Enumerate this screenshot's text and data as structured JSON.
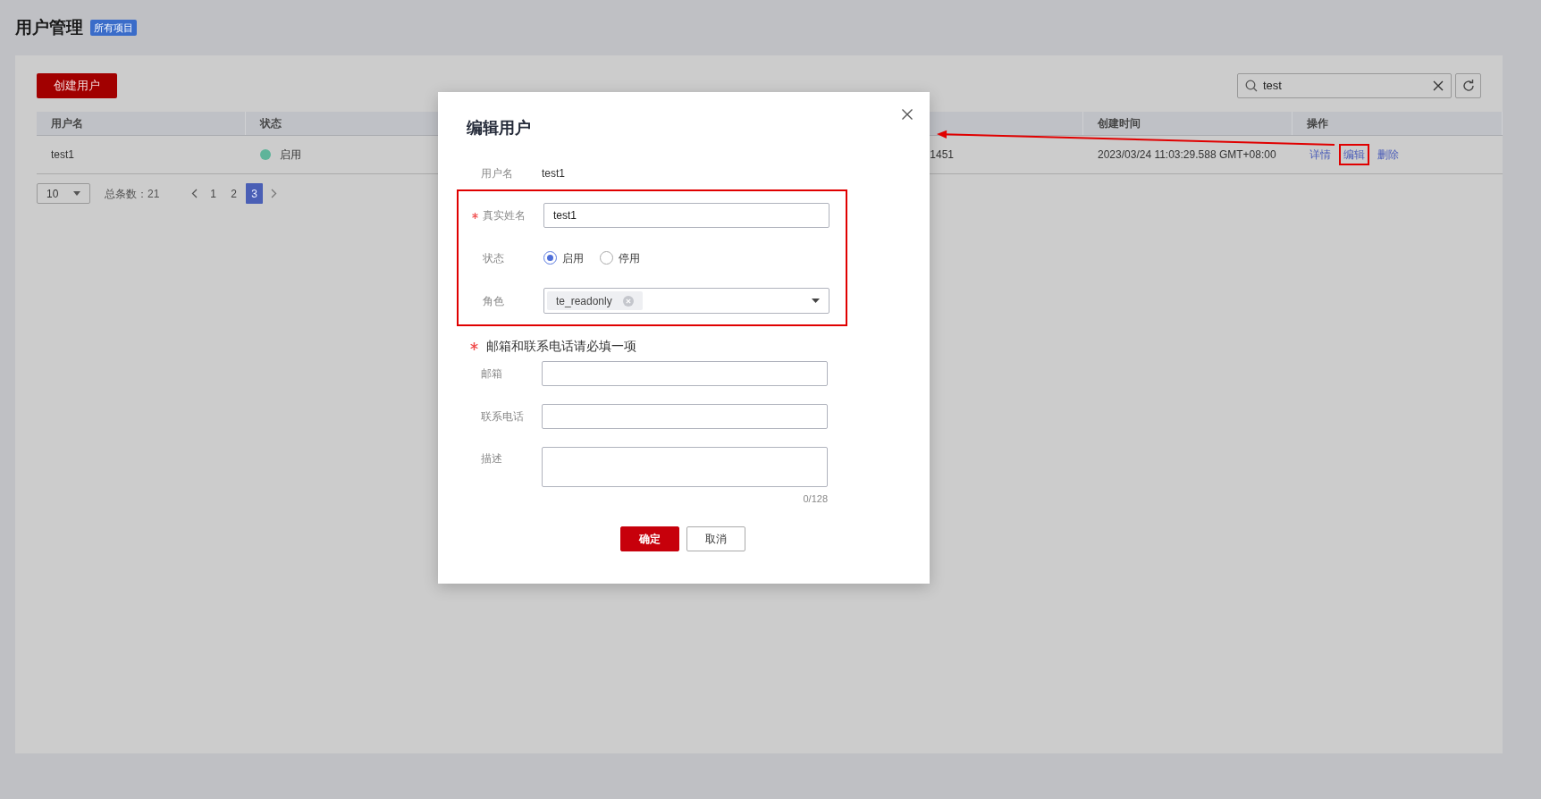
{
  "header": {
    "title": "用户管理",
    "badge": "所有项目"
  },
  "toolbar": {
    "create_button": "创建用户",
    "search": {
      "value": "test"
    }
  },
  "table": {
    "columns": [
      {
        "kind": "name",
        "label": "用户名"
      },
      {
        "kind": "status",
        "label": "状态"
      },
      {
        "kind": "hidden"
      },
      {
        "kind": "created",
        "label": "创建时间"
      },
      {
        "kind": "actions",
        "label": "操作"
      }
    ],
    "rows": [
      {
        "username": "test1",
        "status": {
          "label": "启用",
          "color": "#5fb49a"
        },
        "column_3": "1451",
        "created": "2023/03/24 11:03:29.588 GMT+08:00",
        "actions": [
          {
            "label": "详情",
            "highlighted": false
          },
          {
            "label": "编辑",
            "highlighted": true
          },
          {
            "label": "删除",
            "highlighted": false
          }
        ]
      }
    ]
  },
  "pagination": {
    "page_size": "10",
    "total": "总条数：21",
    "pages": [
      {
        "label": "1",
        "selected": false
      },
      {
        "label": "2",
        "selected": false
      },
      {
        "label": "3",
        "selected": true
      }
    ]
  },
  "dialog": {
    "title": "编辑用户",
    "fields": [
      {
        "kind": "text",
        "label": "用户名",
        "value": "test1",
        "required": false,
        "highlighted": false
      },
      {
        "kind": "input",
        "label": "真实姓名",
        "value": "test1",
        "required": true,
        "highlighted": true
      },
      {
        "kind": "radio",
        "label": "状态",
        "required": false,
        "highlighted": true,
        "options": [
          {
            "label": "启用",
            "selected": true
          },
          {
            "label": "停用",
            "selected": false
          }
        ]
      },
      {
        "kind": "select",
        "label": "角色",
        "required": false,
        "highlighted": true,
        "tags": [
          "te_readonly"
        ]
      },
      {
        "kind": "note",
        "label": "邮箱和联系电话请必填一项",
        "required": true,
        "highlighted": false
      },
      {
        "kind": "input",
        "label": "邮箱",
        "required": false,
        "highlighted": false
      },
      {
        "kind": "input",
        "label": "联系电话",
        "required": false,
        "highlighted": false
      },
      {
        "kind": "textarea",
        "label": "描述",
        "counter": "0/128",
        "required": false,
        "highlighted": false
      }
    ],
    "buttons": [
      {
        "label": "确定",
        "kind": "primary"
      },
      {
        "label": "取消",
        "kind": "secondary"
      }
    ]
  }
}
